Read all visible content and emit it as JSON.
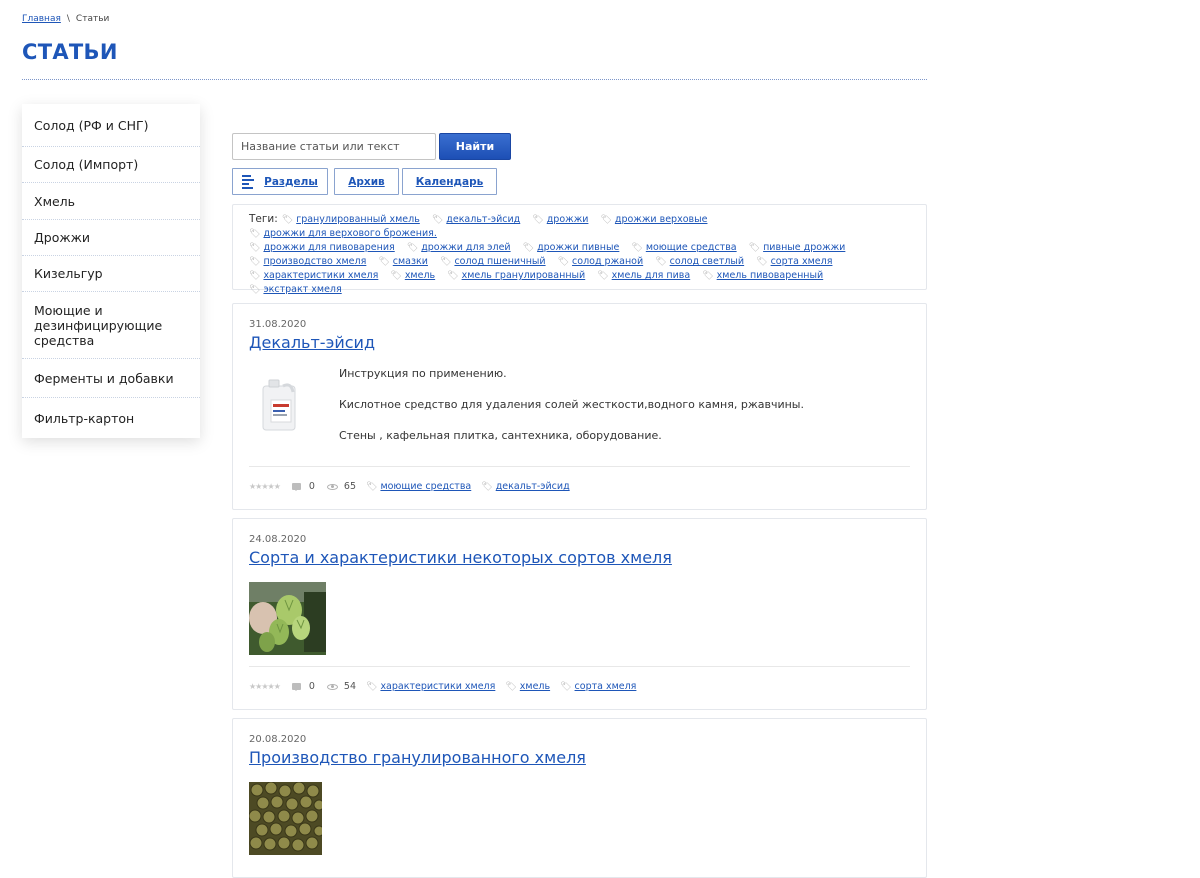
{
  "breadcrumb": {
    "home": "Главная",
    "separator": "\\",
    "current": "Статьи"
  },
  "page_title": "СТАТЬИ",
  "sidebar": {
    "items": [
      {
        "label": "Солод (РФ и СНГ)"
      },
      {
        "label": "Солод (Импорт)"
      },
      {
        "label": "Хмель"
      },
      {
        "label": "Дрожжи"
      },
      {
        "label": "Кизельгур"
      },
      {
        "label": "Моющие и дезинфицирующие средства"
      },
      {
        "label": "Ферменты и добавки"
      },
      {
        "label": "Фильтр-картон"
      }
    ]
  },
  "search": {
    "placeholder": "Название статьи или текст",
    "value": "",
    "button": "Найти"
  },
  "tabs": [
    {
      "label": "Разделы"
    },
    {
      "label": "Архив"
    },
    {
      "label": "Календарь"
    }
  ],
  "tags": {
    "label": "Теги:",
    "items": [
      "гранулированный хмель",
      "декальт-эйсид",
      "дрожжи",
      "дрожжи верховые",
      "дрожжи для верхового брожения.",
      "дрожжи для пивоварения",
      "дрожжи для элей",
      "дрожжи пивные",
      "моющие средства",
      "пивные дрожжи",
      "производство хмеля",
      "смазки",
      "солод пшеничный",
      "солод ржаной",
      "солод светлый",
      "сорта хмеля",
      "характеристики хмеля",
      "хмель",
      "хмель гранулированный",
      "хмель для пива",
      "хмель пивоваренный",
      "экстракт хмеля"
    ]
  },
  "articles": [
    {
      "date": "31.08.2020",
      "title": "Декальт-эйсид",
      "body": [
        "Инструкция по применению.",
        "Кислотное средство для удаления солей жесткости,водного камня, ржавчины.",
        "Стены , кафельная плитка, сантехника, оборудование."
      ],
      "comments": "0",
      "views": "65",
      "tags": [
        "моющие средства",
        "декальт-эйсид"
      ]
    },
    {
      "date": "24.08.2020",
      "title": "Сорта и характеристики некоторых сортов хмеля",
      "comments": "0",
      "views": "54",
      "tags": [
        "характеристики хмеля",
        "хмель",
        "сорта хмеля"
      ]
    },
    {
      "date": "20.08.2020",
      "title": "Производство гранулированного хмеля"
    }
  ],
  "icons": {
    "tag": "tag-icon",
    "comment": "comment-icon",
    "views": "eye-icon",
    "rating": "star-icon",
    "sections": "list-icon"
  },
  "colors": {
    "accent": "#1e56b8",
    "button": "#2b5fc4",
    "border": "#e4e7ec"
  }
}
